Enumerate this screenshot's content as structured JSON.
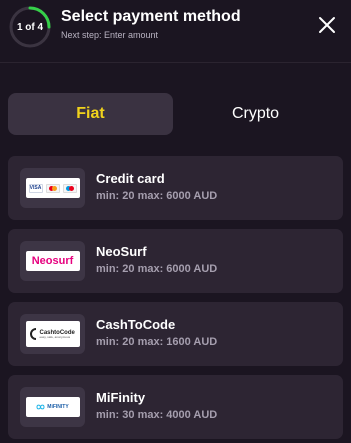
{
  "header": {
    "step": "1 of 4",
    "step_progress": 0.25,
    "title": "Select payment method",
    "subtitle": "Next step: Enter amount"
  },
  "tabs": [
    {
      "label": "Fiat",
      "selected": true
    },
    {
      "label": "Crypto",
      "selected": false
    }
  ],
  "methods": [
    {
      "name": "Credit card",
      "limits": "min: 20 max: 6000 AUD",
      "logo": "visa-mastercard-maestro-logo",
      "logo_text": "VISA"
    },
    {
      "name": "NeoSurf",
      "limits": "min: 20 max: 6000 AUD",
      "logo": "neosurf-logo",
      "logo_text": "Neosurf"
    },
    {
      "name": "CashToCode",
      "limits": "min: 20 max: 1600 AUD",
      "logo": "cashtocode-logo",
      "logo_text": "CashtoCode",
      "logo_tagline": "easy, safe, anonymous"
    },
    {
      "name": "MiFinity",
      "limits": "min: 30 max: 4000 AUD",
      "logo": "mifinity-logo",
      "logo_text": "MiFINITY"
    }
  ],
  "colors": {
    "background": "#1b1521",
    "card": "#2d2533",
    "accent": "#f0d21c",
    "progress": "#35d049"
  }
}
